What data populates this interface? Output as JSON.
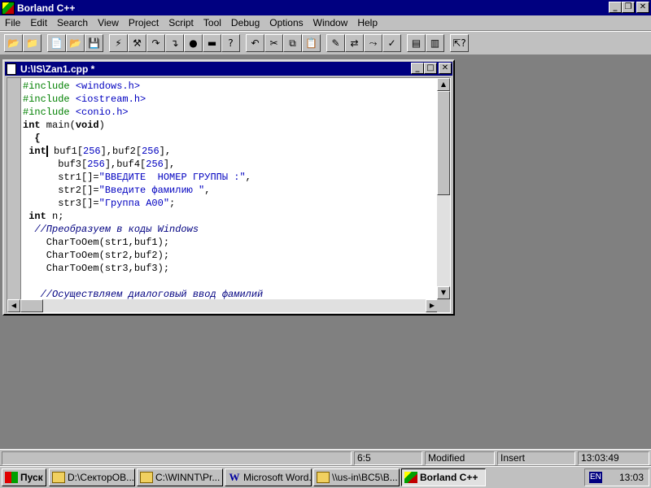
{
  "app": {
    "title": "Borland C++",
    "minimize": "_",
    "restore": "❐",
    "close": "✕"
  },
  "menu": [
    "File",
    "Edit",
    "Search",
    "View",
    "Project",
    "Script",
    "Tool",
    "Debug",
    "Options",
    "Window",
    "Help"
  ],
  "toolbar": [
    {
      "name": "open-project-button",
      "glyph": "📂"
    },
    {
      "name": "close-project-button",
      "glyph": "📁"
    },
    {
      "sep": true
    },
    {
      "name": "new-file-button",
      "glyph": "📄"
    },
    {
      "name": "open-file-button",
      "glyph": "📂"
    },
    {
      "name": "save-file-button",
      "glyph": "💾"
    },
    {
      "sep": true
    },
    {
      "name": "compile-button",
      "glyph": "⚡"
    },
    {
      "name": "make-button",
      "glyph": "⚒"
    },
    {
      "name": "step-over-button",
      "glyph": "↷"
    },
    {
      "name": "trace-into-button",
      "glyph": "↴"
    },
    {
      "name": "breakpoint-button",
      "glyph": "●"
    },
    {
      "name": "pause-button",
      "glyph": "▬"
    },
    {
      "name": "evaluate-button",
      "glyph": "?"
    },
    {
      "sep": true
    },
    {
      "name": "undo-button",
      "glyph": "↶"
    },
    {
      "name": "cut-button",
      "glyph": "✂"
    },
    {
      "name": "copy-button",
      "glyph": "⧉"
    },
    {
      "name": "paste-button",
      "glyph": "📋"
    },
    {
      "sep": true
    },
    {
      "name": "find-button",
      "glyph": "✎"
    },
    {
      "name": "replace-button",
      "glyph": "⇄"
    },
    {
      "name": "search-again-button",
      "glyph": "⤳"
    },
    {
      "name": "browse-button",
      "glyph": "✓"
    },
    {
      "sep": true
    },
    {
      "name": "tile-button",
      "glyph": "▤"
    },
    {
      "name": "cascade-button",
      "glyph": "▥"
    },
    {
      "sep": true
    },
    {
      "name": "help-button",
      "glyph": "⇱?"
    }
  ],
  "editor": {
    "title": "U:\\IS\\Zan1.cpp *",
    "code_lines": [
      [
        {
          "t": "#include ",
          "c": "pp"
        },
        {
          "t": "<windows.h>",
          "c": "hdr"
        }
      ],
      [
        {
          "t": "#include ",
          "c": "pp"
        },
        {
          "t": "<iostream.h>",
          "c": "hdr"
        }
      ],
      [
        {
          "t": "#include ",
          "c": "pp"
        },
        {
          "t": "<conio.h>",
          "c": "hdr"
        }
      ],
      [
        {
          "t": "int",
          "c": "kw"
        },
        {
          "t": " main(",
          "c": ""
        },
        {
          "t": "void",
          "c": "kw"
        },
        {
          "t": ")",
          "c": ""
        }
      ],
      [
        {
          "t": "  {",
          "c": "kw"
        }
      ],
      [
        {
          "t": " int",
          "c": "kw"
        },
        {
          "t": "",
          "c": "caret"
        },
        {
          "t": " buf1[",
          "c": ""
        },
        {
          "t": "256",
          "c": "num"
        },
        {
          "t": "],buf2[",
          "c": ""
        },
        {
          "t": "256",
          "c": "num"
        },
        {
          "t": "],",
          "c": ""
        }
      ],
      [
        {
          "t": "      buf3[",
          "c": ""
        },
        {
          "t": "256",
          "c": "num"
        },
        {
          "t": "],buf4[",
          "c": ""
        },
        {
          "t": "256",
          "c": "num"
        },
        {
          "t": "],",
          "c": ""
        }
      ],
      [
        {
          "t": "      str1[]=",
          "c": ""
        },
        {
          "t": "\"ВВЕДИТЕ  НОМЕР ГРУППЫ :\"",
          "c": "str"
        },
        {
          "t": ",",
          "c": ""
        }
      ],
      [
        {
          "t": "      str2[]=",
          "c": ""
        },
        {
          "t": "\"Введите фамилию \"",
          "c": "str"
        },
        {
          "t": ",",
          "c": ""
        }
      ],
      [
        {
          "t": "      str3[]=",
          "c": ""
        },
        {
          "t": "\"Группа А00\"",
          "c": "str"
        },
        {
          "t": ";",
          "c": ""
        }
      ],
      [
        {
          "t": " int",
          "c": "kw"
        },
        {
          "t": " n;",
          "c": ""
        }
      ],
      [
        {
          "t": "  //Преобразуем в коды Windows",
          "c": "cmt"
        }
      ],
      [
        {
          "t": "    CharToOem(str1,buf1);",
          "c": ""
        }
      ],
      [
        {
          "t": "    CharToOem(str2,buf2);",
          "c": ""
        }
      ],
      [
        {
          "t": "    CharToOem(str3,buf3);",
          "c": ""
        }
      ],
      [
        {
          "t": "",
          "c": ""
        }
      ],
      [
        {
          "t": "   //Осуществляем диалоговый ввод фамилий",
          "c": "cmt"
        }
      ]
    ]
  },
  "status": {
    "message": "",
    "position": "6:5",
    "modified": "Modified",
    "mode": "Insert",
    "time": "13:03:49"
  },
  "taskbar": {
    "start": "Пуск",
    "tasks": [
      {
        "label": "D:\\СекторОВ...",
        "icon": "folder",
        "active": false
      },
      {
        "label": "C:\\WINNT\\Pr...",
        "icon": "folder",
        "active": false
      },
      {
        "label": "Microsoft Word...",
        "icon": "word",
        "active": false
      },
      {
        "label": "\\\\us-in\\BC5\\B...",
        "icon": "folder",
        "active": false
      },
      {
        "label": "Borland C++",
        "icon": "bc",
        "active": true
      }
    ],
    "lang": "EN",
    "clock": "13:03"
  }
}
